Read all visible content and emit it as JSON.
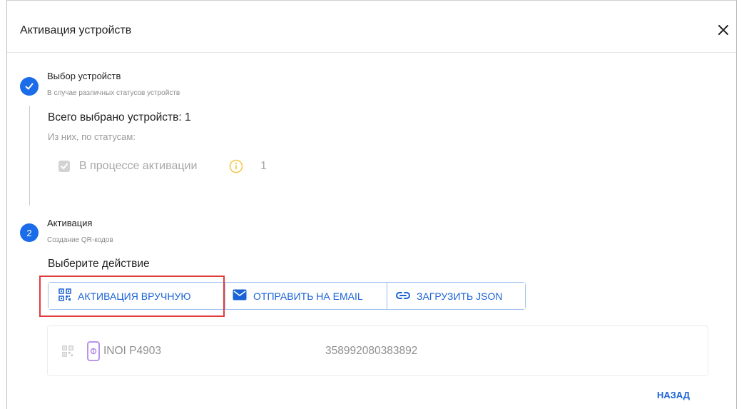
{
  "dialog": {
    "title": "Активация устройств",
    "close_icon": "close-icon"
  },
  "step1": {
    "title": "Выбор устройств",
    "subtitle": "В случае различных статусов устройств",
    "icon": "check-icon",
    "total_label": "Всего выбрано устройств: 1",
    "by_status_label": "Из них, по статусам:",
    "statuses": [
      {
        "label": "В процессе активации",
        "count": "1",
        "checked": true,
        "icon": "info-icon"
      }
    ]
  },
  "step2": {
    "number": "2",
    "title": "Активация",
    "subtitle": "Создание QR-кодов",
    "action_prompt": "Выберите действие",
    "actions": [
      {
        "label": "АКТИВАЦИЯ ВРУЧНУЮ",
        "icon": "qr-code-icon",
        "highlighted": true
      },
      {
        "label": "ОТПРАВИТЬ НА EMAIL",
        "icon": "email-icon"
      },
      {
        "label": "ЗАГРУЗИТЬ JSON",
        "icon": "link-icon"
      }
    ],
    "device": {
      "name": "INOI P4903",
      "imei": "358992080383892",
      "icons": [
        "qr-code-icon",
        "phone-icon"
      ]
    }
  },
  "footer": {
    "back_label": "НАЗАД"
  },
  "colors": {
    "accent": "#1a6ce8",
    "button_text": "#1a63d6",
    "highlight": "#e03c3c",
    "warning": "#f3c84b"
  }
}
